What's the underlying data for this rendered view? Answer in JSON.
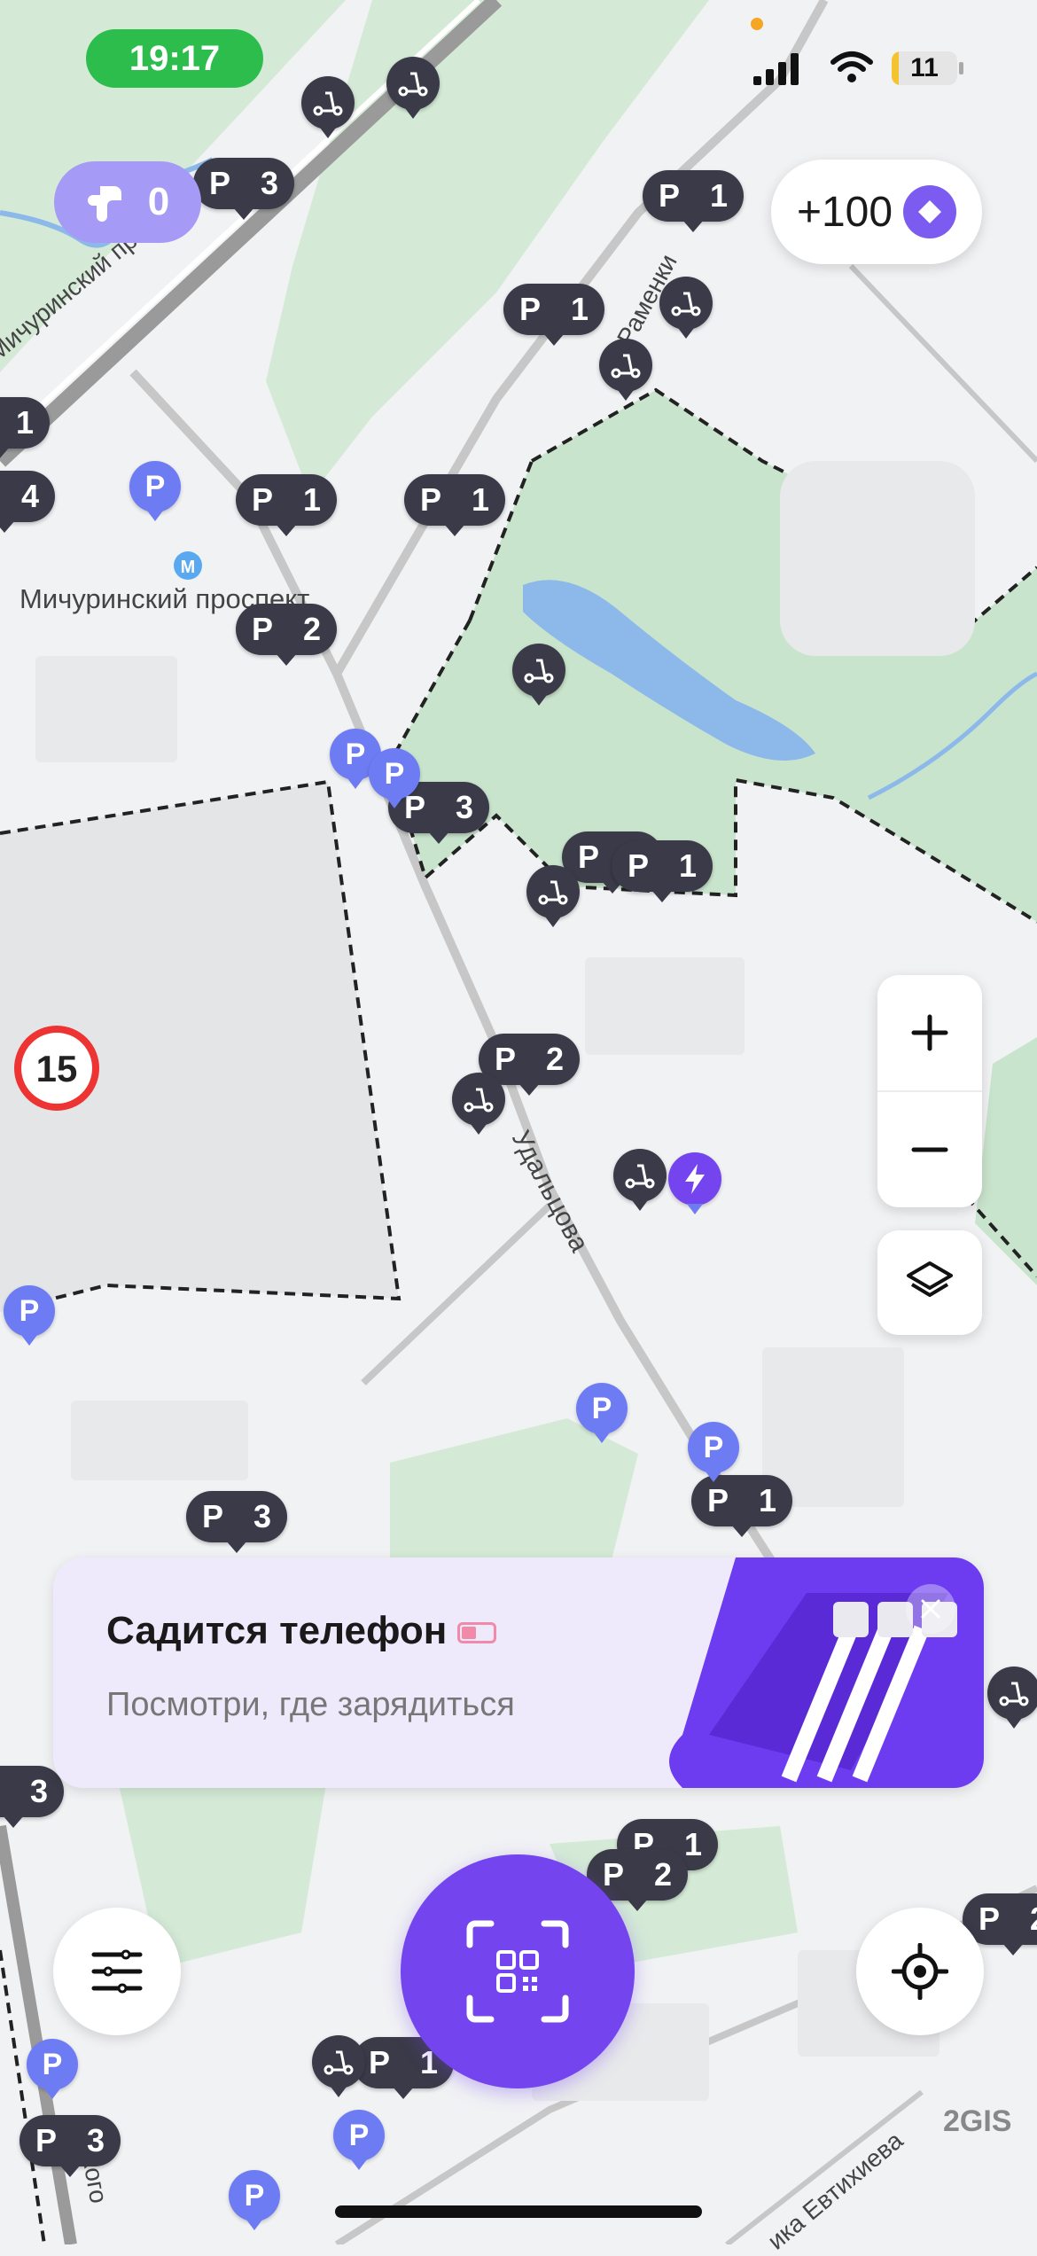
{
  "status_bar": {
    "time": "19:17",
    "battery": "11",
    "battery_level_percent": 11,
    "icons": [
      "signal-icon",
      "wifi-icon",
      "battery-icon"
    ]
  },
  "top": {
    "kick_counter": "0",
    "bonus": "+100"
  },
  "map": {
    "labels": {
      "street_michurinsky": "Мичуринский проспект",
      "metro_station": "Мичуринский проспект",
      "street_ramenki": "Раменки",
      "street_udaltsova": "Удальцова",
      "street_evtikhieva": "ика Евтихиева",
      "street_bottom_left": "кого",
      "speed_limit": "15",
      "attribution": "2GIS"
    },
    "parking": [
      {
        "p": "P",
        "n": "3"
      },
      {
        "p": "P",
        "n": "1"
      },
      {
        "p": "P",
        "n": "1"
      },
      {
        "p": "P",
        "n": "1"
      },
      {
        "p": "P",
        "n": "1"
      },
      {
        "p": "P",
        "n": "2"
      },
      {
        "p": "P",
        "n": "3"
      },
      {
        "p": "P",
        "n": "1"
      },
      {
        "p": "P",
        "n": "1"
      },
      {
        "p": "P",
        "n": "2"
      },
      {
        "p": "P",
        "n": "3"
      },
      {
        "p": "P",
        "n": "1"
      },
      {
        "p": "P",
        "n": "1"
      },
      {
        "p": "P",
        "n": "2"
      },
      {
        "p": "P",
        "n": "1"
      },
      {
        "p": "P",
        "n": "3"
      },
      {
        "p": "P",
        "n": "3"
      },
      {
        "p": "P",
        "n": "2"
      },
      {
        "p": "P",
        "n": "4"
      },
      {
        "p": "P",
        "n": "1"
      }
    ],
    "blue_p": "P"
  },
  "promo": {
    "title": "Садится телефон",
    "subtitle": "Посмотри, где зарядиться"
  },
  "colors": {
    "accent": "#7444ee",
    "marker": "#3b3a48",
    "park": "#c9e4cc",
    "green_status": "#2dbd4c"
  }
}
